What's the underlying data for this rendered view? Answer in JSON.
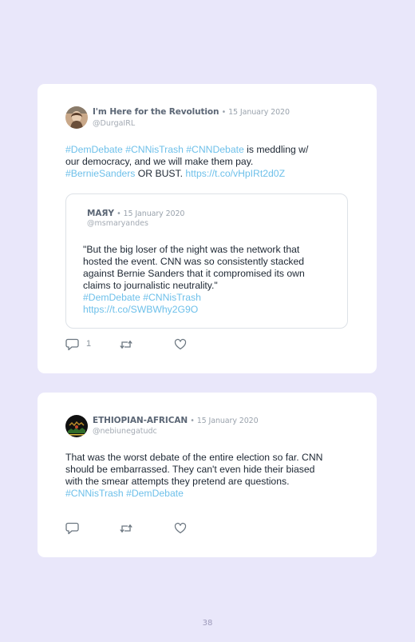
{
  "tweets": [
    {
      "name": "I'm Here for the Revolution",
      "date": "• 15 January 2020",
      "handle": "@DurgaIRL",
      "body": {
        "t1": "#DemDebate",
        "t2": "#CNNisTrash",
        "t3": "#CNNDebate",
        "p1": " is meddling w/",
        "p2": "our democracy, and we will make them pay.",
        "t4": "#BernieSanders",
        "p3": " OR BUST. ",
        "link": "https://t.co/vHpIRt2d0Z"
      },
      "quote": {
        "name": "MAЯY",
        "date": "• 15 January 2020",
        "handle": "@msmaryandes",
        "lines": [
          "\"But the big loser of the night was the network that",
          "hosted the event. CNN was so consistently stacked",
          "against Bernie Sanders that it compromised its own",
          "claims to journalistic neutrality.\""
        ],
        "t1": "#DemDebate",
        "t2": "#CNNisTrash",
        "link": "https://t.co/SWBWhy2G9O"
      },
      "reply_count": "1"
    },
    {
      "name": "ETHIOPIAN-AFRICAN",
      "date": "• 15 January 2020",
      "handle": "@nebiunegatudc",
      "body": {
        "lines": [
          "That was the worst debate of the entire election so far. CNN",
          "should be embarrassed. They can't even hide their biased",
          "with the smear attempts they pretend are questions."
        ],
        "t1": "#CNNisTrash",
        "t2": "#DemDebate"
      }
    }
  ],
  "page_number": "38",
  "colors": {
    "background": "#e9e7fa",
    "hashtag": "#6ec0ea",
    "card": "#ffffff"
  }
}
